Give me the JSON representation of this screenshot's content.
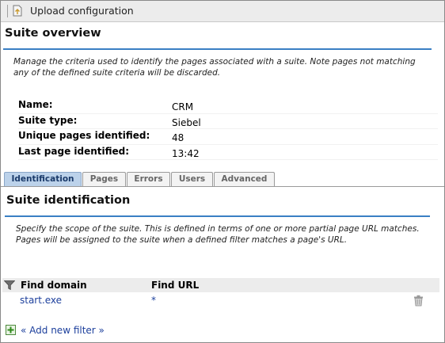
{
  "toolbar": {
    "upload_label": "Upload configuration"
  },
  "overview": {
    "title": "Suite overview",
    "description": "Manage the criteria used to identify the pages associated with a suite. Note pages not matching any of the defined suite criteria will be discarded.",
    "fields": [
      {
        "label": "Name:",
        "value": "CRM"
      },
      {
        "label": "Suite type:",
        "value": "Siebel"
      },
      {
        "label": "Unique pages identified:",
        "value": "48"
      },
      {
        "label": "Last page identified:",
        "value": "13:42"
      }
    ]
  },
  "tabs": [
    {
      "label": "Identification",
      "active": true
    },
    {
      "label": "Pages",
      "active": false
    },
    {
      "label": "Errors",
      "active": false
    },
    {
      "label": "Users",
      "active": false
    },
    {
      "label": "Advanced",
      "active": false
    }
  ],
  "identification": {
    "title": "Suite identification",
    "description": "Specify the scope of the suite. This is defined in terms of one or more partial page URL matches. Pages will be assigned to the suite when a defined filter matches a page's URL.",
    "columns": {
      "domain": "Find domain",
      "url": "Find URL"
    },
    "filters": [
      {
        "domain": "start.exe",
        "url": "*"
      }
    ],
    "add_filter_label": "« Add new filter »"
  },
  "colors": {
    "accent_rule": "#3a7fc4",
    "active_tab": "#bcd2ea",
    "link": "#1c3f9c"
  },
  "icons": {
    "upload": "upload-icon",
    "filter": "filter-icon",
    "delete": "trash-icon",
    "add": "add-icon"
  }
}
